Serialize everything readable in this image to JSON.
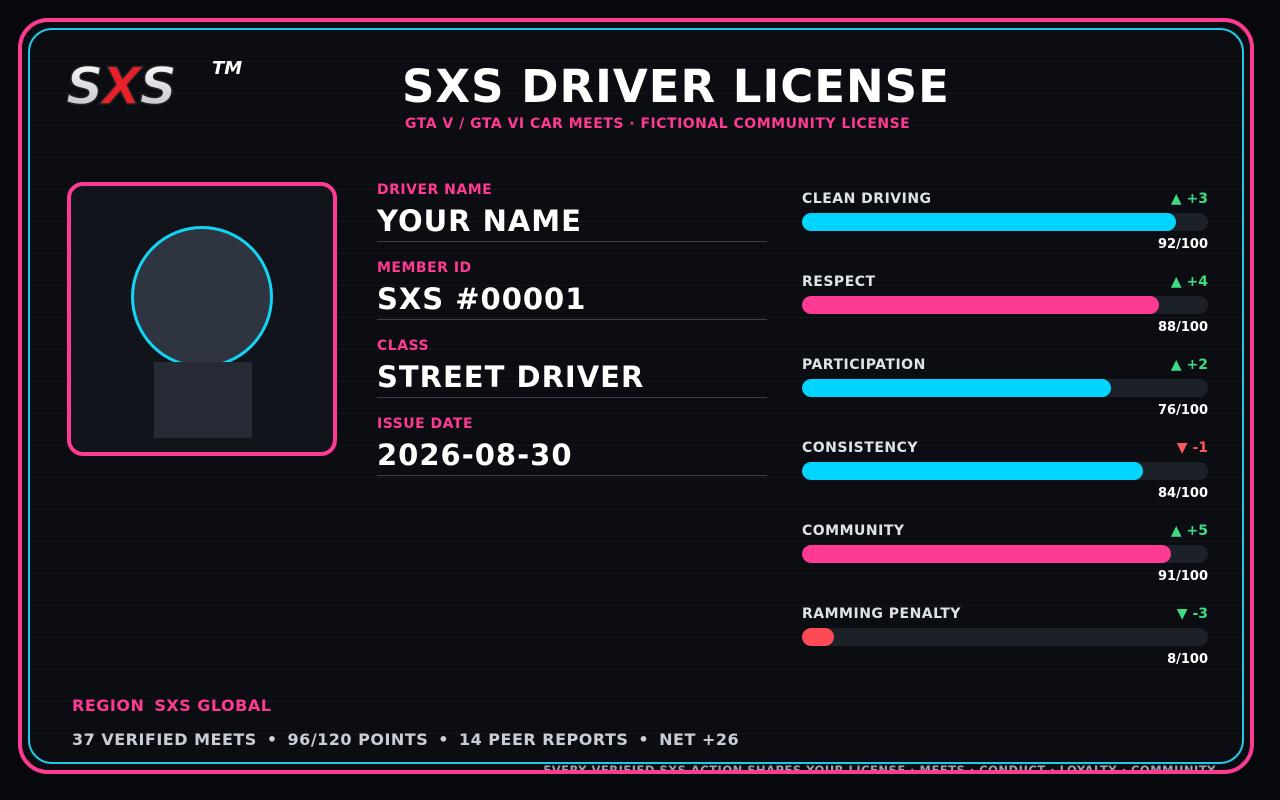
{
  "brand": {
    "logo_text": "SXS",
    "trademark": "TM"
  },
  "header": {
    "title": "SXS DRIVER LICENSE",
    "subtitle": "GTA V / GTA VI CAR MEETS · FICTIONAL COMMUNITY LICENSE"
  },
  "fields": [
    {
      "label": "DRIVER NAME",
      "value": "YOUR NAME"
    },
    {
      "label": "MEMBER ID",
      "value": "SXS #00001"
    },
    {
      "label": "CLASS",
      "value": "STREET DRIVER"
    },
    {
      "label": "ISSUE DATE",
      "value": "2026-08-30"
    }
  ],
  "stats": [
    {
      "name": "CLEAN DRIVING",
      "delta": "▲ +3",
      "delta_color": "#3ddc84",
      "score": "92/100",
      "value": 92,
      "color": "#00d4ff"
    },
    {
      "name": "RESPECT",
      "delta": "▲ +4",
      "delta_color": "#3ddc84",
      "score": "88/100",
      "value": 88,
      "color": "#ff3a93"
    },
    {
      "name": "PARTICIPATION",
      "delta": "▲ +2",
      "delta_color": "#3ddc84",
      "score": "76/100",
      "value": 76,
      "color": "#00d4ff"
    },
    {
      "name": "CONSISTENCY",
      "delta": "▼ -1",
      "delta_color": "#ff5a5a",
      "score": "84/100",
      "value": 84,
      "color": "#00d4ff"
    },
    {
      "name": "COMMUNITY",
      "delta": "▲ +5",
      "delta_color": "#3ddc84",
      "score": "91/100",
      "value": 91,
      "color": "#ff3a93"
    },
    {
      "name": "RAMMING PENALTY",
      "delta": "▼ -3",
      "delta_color": "#3ddc84",
      "score": "8/100",
      "value": 8,
      "color": "#ff4a55"
    }
  ],
  "region": {
    "label": "REGION",
    "value": "SXS GLOBAL"
  },
  "summary": {
    "meets": "37 VERIFIED MEETS",
    "points": "96/120 POINTS",
    "reports": "14 PEER REPORTS",
    "net": "NET +26",
    "separator": "•"
  },
  "footer": "EVERY VERIFIED SXS ACTION SHAPES YOUR LICENSE · MEETS · CONDUCT · LOYALTY · COMMUNITY",
  "colors": {
    "accent_pink": "#ff3a93",
    "accent_cyan": "#22c8e8",
    "background": "#0b0d12"
  }
}
